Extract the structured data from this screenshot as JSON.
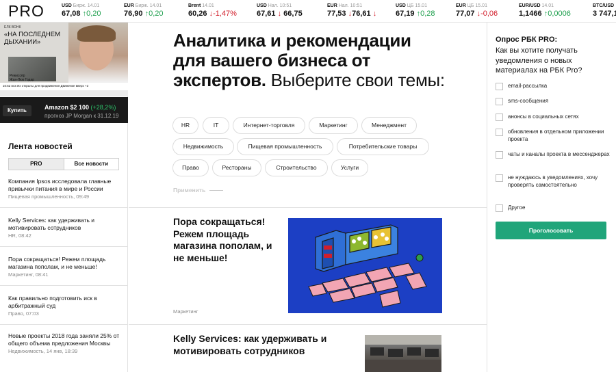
{
  "header": {
    "logo": "PRO",
    "tickers": [
      {
        "label_strong": "USD",
        "label_rest": " Бирж. 14.01",
        "value": "67,08",
        "change": "↑0,20",
        "dir": "up"
      },
      {
        "label_strong": "EUR",
        "label_rest": " Бирж. 14.01",
        "value": "76,90",
        "change": "↑0,20",
        "dir": "up"
      },
      {
        "label_strong": "Brent",
        "label_rest": " 14.01",
        "value": "60,26",
        "change": "↓-1,47%",
        "dir": "dn"
      },
      {
        "label_strong": "USD",
        "label_rest": " Нал. 10:51",
        "value": "67,61",
        "change": "",
        "value2": "66,75",
        "change2": "↓",
        "dir": "dn2"
      },
      {
        "label_strong": "EUR",
        "label_rest": " Нал. 10:51",
        "value": "77,53",
        "change": "↓",
        "value2": "76,61",
        "change2": "↓",
        "dir": "dn2"
      },
      {
        "label_strong": "USD",
        "label_rest": " ЦБ 15.01",
        "value": "67,19",
        "change": "↑0,28",
        "dir": "up"
      },
      {
        "label_strong": "EUR",
        "label_rest": " ЦБ 15.01",
        "value": "77,07",
        "change": "↓-0,06",
        "dir": "dn"
      },
      {
        "label_strong": "EUR/USD",
        "label_rest": " 14.01",
        "value": "1,1466",
        "change": "↑0,0006",
        "dir": "up"
      },
      {
        "label_strong": "BTC/USD",
        "label_rest": "",
        "value": "3 747,1",
        "change": "",
        "dir": "up"
      }
    ]
  },
  "video": {
    "small_header": "ЕЛК ВОНК",
    "title": "«НА ПОСЛЕДНЕМ ДЫХАНИИ»",
    "caption": "Режиссёр\nЖан-Люк Годар",
    "strip_text": "10:52 мск   Их открыты для продвижения   Движение вверх +3"
  },
  "stock": {
    "buy_label": "Купить",
    "name": "Amazon $2 100",
    "change": "(+28,2%)",
    "sub": "прогноз JP Morgan к 31.12.19"
  },
  "feed": {
    "title": "Лента новостей",
    "tabs": [
      "PRO",
      "Все новости"
    ],
    "items": [
      {
        "title": "Компания Ipsos исследовала главные привычки питания в мире и России",
        "meta": "Пищевая промышленность, 09:49"
      },
      {
        "title": "Kelly Services: как удерживать и мотивировать сотрудников",
        "meta": "HR, 08:42"
      },
      {
        "title": "Пора сокращаться! Режем площадь магазина пополам, и не меньше!",
        "meta": "Маркетинг, 08:41"
      },
      {
        "title": "Как правильно подготовить иск в арбитражный суд",
        "meta": "Право, 07:03"
      },
      {
        "title": "Новые проекты 2018 года заняли 25% от общего объема предложения Москвы",
        "meta": "Недвижимость, 14 янв, 18:39"
      }
    ]
  },
  "main": {
    "headline_bold": "Аналитика и рекомендации для вашего бизнеса от экспертов.",
    "headline_light": " Выберите свои темы:",
    "tags": [
      "HR",
      "IT",
      "Интернет-торговля",
      "Маркетинг",
      "Менеджмент",
      "Недвижимость",
      "Пищевая промышленность",
      "Потребительские товары",
      "Право",
      "Рестораны",
      "Строительство",
      "Услуги"
    ],
    "apply_label": "Применить",
    "article1": {
      "title": "Пора сокращаться! Режем площадь магазина пополам, и не меньше!",
      "category": "Маркетинг"
    },
    "article2": {
      "title": "Kelly Services: как удерживать и мотивировать сотрудников"
    }
  },
  "poll": {
    "title": "Опрос РБК PRO:",
    "question": "Как вы хотите получать уведомления о новых материалах на РБК Pro?",
    "options": [
      "email-рассылка",
      "sms-сообщения",
      "анонсы в социальных сетях",
      "обновления в отдельном приложении проекта",
      "чаты и каналы проекта в мессенджерах",
      "не нуждаюсь в уведомлениях, хочу проверять самостоятельно",
      "Другое"
    ],
    "vote_label": "Проголосовать"
  },
  "colors": {
    "up": "#1b9e4b",
    "down": "#d21e2b",
    "accent": "#20a57a",
    "illustration_bg": "#1c3fc4"
  }
}
